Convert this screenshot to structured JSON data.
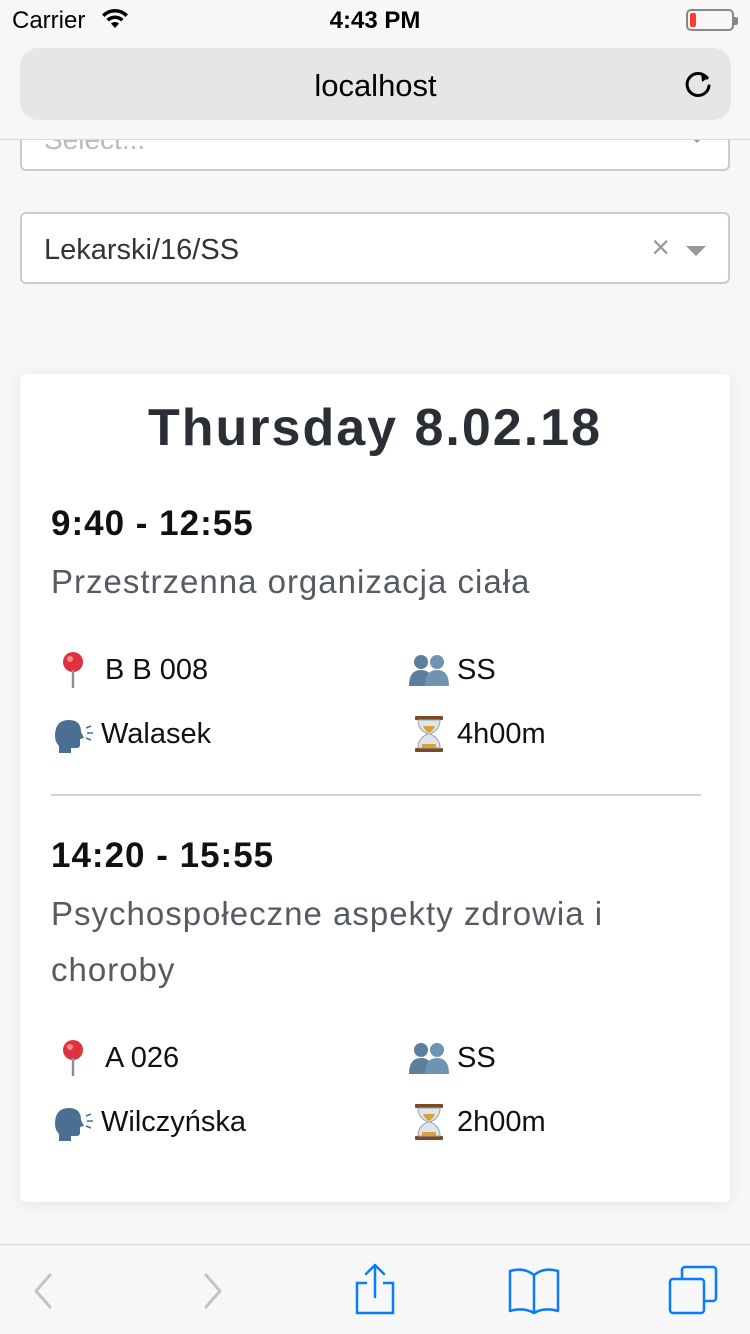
{
  "status_bar": {
    "carrier": "Carrier",
    "time": "4:43 PM"
  },
  "browser": {
    "url": "localhost"
  },
  "selects": [
    {
      "placeholder": "Select..."
    },
    {
      "value": "Lekarski/16/SS",
      "clear_symbol": "×"
    }
  ],
  "day": {
    "title": "Thursday 8.02.18",
    "events": [
      {
        "time": "9:40 - 12:55",
        "name": "Przestrzenna organizacja ciała",
        "room": "B B 008",
        "group": "SS",
        "teacher": "Walasek",
        "duration": "4h00m"
      },
      {
        "time": "14:20 - 15:55",
        "name": "Psychospołeczne aspekty zdrowia i choroby",
        "room": "A 026",
        "group": "SS",
        "teacher": "Wilczyńska",
        "duration": "2h00m"
      }
    ]
  },
  "icons": {
    "room": "pushpin-icon",
    "group": "people-icon",
    "teacher": "speaking-head-icon",
    "duration": "hourglass-icon"
  },
  "colors": {
    "ios_blue": "#0a7aff",
    "battery_low": "#ff3b30"
  }
}
